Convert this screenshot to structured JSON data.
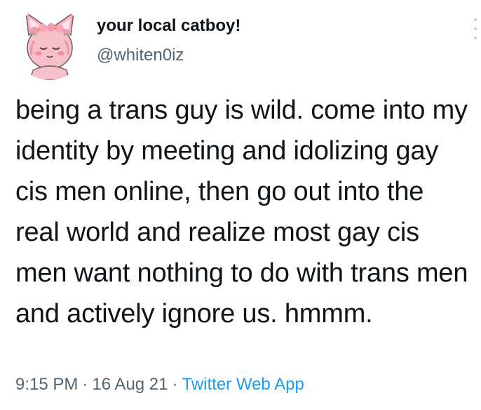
{
  "tweet": {
    "display_name": "your local catboy!",
    "handle": "@whiten0iz",
    "text": "being a trans guy is wild. come into my identity by meeting and idolizing gay cis men online, then go out into the real world and realize most gay cis men want nothing to do with trans men and actively ignore us. hmmm.",
    "time": "9:15 PM",
    "date": "16 Aug 21",
    "source": "Twitter Web App",
    "separator": "·"
  },
  "icons": {
    "avatar": "catboy-avatar-icon",
    "more": "more-options-icon"
  },
  "colors": {
    "text": "#0f1419",
    "secondary": "#536471",
    "link": "#1d9bf0",
    "avatar_pink": "#f4b7c1"
  }
}
